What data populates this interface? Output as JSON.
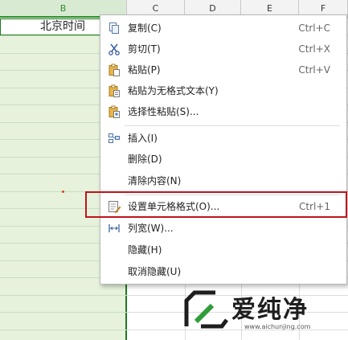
{
  "sheet": {
    "columns": [
      "B",
      "C",
      "D",
      "E",
      "F"
    ],
    "selected_column": "B",
    "b1_value": "北京时间"
  },
  "context_menu": {
    "items": [
      {
        "label": "复制(C)",
        "shortcut": "Ctrl+C",
        "icon": "copy-icon"
      },
      {
        "label": "剪切(T)",
        "shortcut": "Ctrl+X",
        "icon": "cut-icon"
      },
      {
        "label": "粘贴(P)",
        "shortcut": "Ctrl+V",
        "icon": "paste-icon"
      },
      {
        "label": "粘贴为无格式文本(Y)",
        "shortcut": "",
        "icon": "paste-text-icon"
      },
      {
        "label": "选择性粘贴(S)...",
        "shortcut": "",
        "icon": "paste-special-icon"
      },
      {
        "label": "插入(I)",
        "shortcut": "",
        "icon": "insert-icon"
      },
      {
        "label": "删除(D)",
        "shortcut": "",
        "icon": ""
      },
      {
        "label": "清除内容(N)",
        "shortcut": "",
        "icon": ""
      },
      {
        "label": "设置单元格格式(O)...",
        "shortcut": "Ctrl+1",
        "icon": "format-cells-icon"
      },
      {
        "label": "列宽(W)...",
        "shortcut": "",
        "icon": "column-width-icon"
      },
      {
        "label": "隐藏(H)",
        "shortcut": "",
        "icon": ""
      },
      {
        "label": "取消隐藏(U)",
        "shortcut": "",
        "icon": ""
      }
    ],
    "highlight_color": "#c0141a"
  },
  "watermark": {
    "text": "爱纯净",
    "url": "www.aichunjing.com"
  },
  "colors": {
    "selection_border": "#1d7a1d",
    "selection_fill": "#e6f2dc"
  }
}
